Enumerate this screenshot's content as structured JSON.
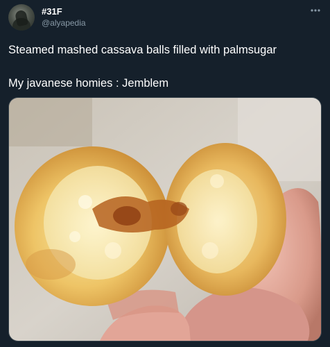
{
  "tweet": {
    "display_name": "#31F",
    "handle": "@alyapedia",
    "text_line1": "Steamed mashed cassava balls filled with palmsugar",
    "text_line2": "My javanese homies : Jemblem"
  },
  "icons": {
    "avatar": "user-avatar",
    "more": "more-options-icon"
  },
  "colors": {
    "background": "#15202b",
    "secondary_text": "#8899a6",
    "border": "#38444d"
  }
}
